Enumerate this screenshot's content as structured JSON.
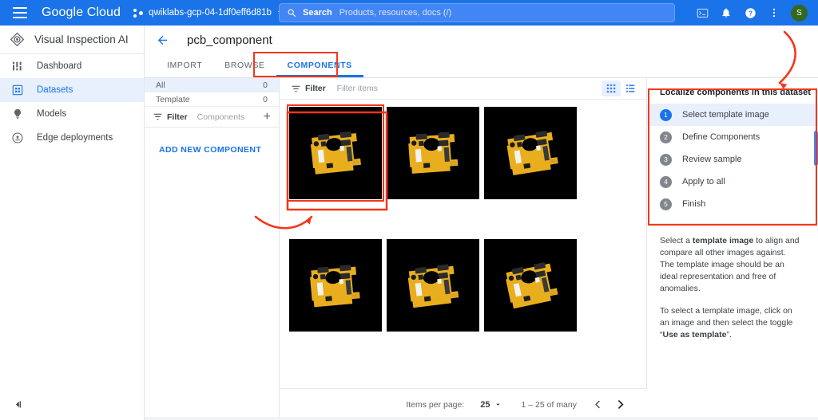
{
  "topbar": {
    "menu_icon": "hamburger-menu-icon",
    "logo": "Google Cloud",
    "project_selector_icon": "project-scope-icon",
    "project_name": "qwiklabs-gcp-04-1df0eff6d81b",
    "project_caret_icon": "chevron-down-icon",
    "search": {
      "icon": "search-icon",
      "label": "Search",
      "placeholder": "Products, resources, docs (/)"
    },
    "icons": [
      {
        "name": "cloud-shell-icon",
        "glyph": ">_"
      },
      {
        "name": "notifications-bell-icon",
        "glyph": "bell"
      },
      {
        "name": "help-icon",
        "glyph": "?"
      },
      {
        "name": "more-vert-icon",
        "glyph": "⋮"
      }
    ],
    "avatar_initial": "S",
    "avatar_color": "#34681f",
    "bar_color": "#1a73e8"
  },
  "sidebar": {
    "product_icon": "visual-inspection-ai-icon",
    "product_title": "Visual Inspection AI",
    "items": [
      {
        "label": "Dashboard",
        "icon": "dashboard-icon",
        "active": false
      },
      {
        "label": "Datasets",
        "icon": "datasets-icon",
        "active": true
      },
      {
        "label": "Models",
        "icon": "models-icon",
        "active": false
      },
      {
        "label": "Edge deployments",
        "icon": "edge-deployments-icon",
        "active": false
      }
    ],
    "collapse_icon": "collapse-panel-icon",
    "active_color": "#1a73e8",
    "active_bg": "#e8f0fe"
  },
  "page": {
    "back_icon": "back-arrow-icon",
    "title": "pcb_component",
    "tabs": [
      {
        "label": "IMPORT",
        "active": false
      },
      {
        "label": "BROWSE",
        "active": false
      },
      {
        "label": "COMPONENTS",
        "active": true
      }
    ]
  },
  "facets": {
    "rows": [
      {
        "label": "All",
        "count": "0",
        "selected": true
      },
      {
        "label": "Template",
        "count": "0",
        "selected": false
      }
    ],
    "filter_icon": "filter-icon",
    "filter_label": "Filter",
    "filter_placeholder": "Components",
    "add_icon": "plus-icon",
    "add_new_component": "ADD NEW COMPONENT"
  },
  "grid": {
    "filter_icon": "filter-icon",
    "filter_label": "Filter",
    "filter_placeholder": "Filter items",
    "view_grid_icon": "grid-view-icon",
    "view_list_icon": "list-view-icon",
    "view_mode": "grid",
    "thumbnails": [
      {
        "alt": "pcb board image 1",
        "selected": true
      },
      {
        "alt": "pcb board image 2",
        "selected": false
      },
      {
        "alt": "pcb board image 3",
        "selected": false
      },
      {
        "alt": "pcb board image 4",
        "selected": false
      },
      {
        "alt": "pcb board image 5",
        "selected": false
      },
      {
        "alt": "pcb board image 6",
        "selected": false
      }
    ],
    "pager": {
      "items_per_page_label": "Items per page:",
      "items_per_page_value": "25",
      "dropdown_icon": "chevron-down-icon",
      "range": "1 – 25 of many",
      "prev_icon": "chevron-left-icon",
      "next_icon": "chevron-right-icon"
    }
  },
  "right_panel": {
    "title": "Localize components in this dataset",
    "steps": [
      {
        "num": "1",
        "label": "Select template image",
        "active": true
      },
      {
        "num": "2",
        "label": "Define Components",
        "active": false
      },
      {
        "num": "3",
        "label": "Review sample",
        "active": false
      },
      {
        "num": "4",
        "label": "Apply to all",
        "active": false
      },
      {
        "num": "5",
        "label": "Finish",
        "active": false
      }
    ],
    "paragraph_1_a": "Select a ",
    "paragraph_1_b": "template image",
    "paragraph_1_c": " to align and compare all other images against. The template image should be an ideal representation and free of anomalies.",
    "paragraph_2_a": "To select a template image, click on an image and then select the toggle “",
    "paragraph_2_b": "Use as template",
    "paragraph_2_c": "”."
  },
  "annotations": {
    "color": "#f4361c",
    "shapes": [
      {
        "name": "highlight-box-components-tab"
      },
      {
        "name": "highlight-box-selected-thumbnail"
      },
      {
        "name": "highlight-box-steps-panel"
      },
      {
        "name": "arrow-to-selected-thumbnail"
      },
      {
        "name": "arrow-to-steps-panel"
      }
    ]
  }
}
